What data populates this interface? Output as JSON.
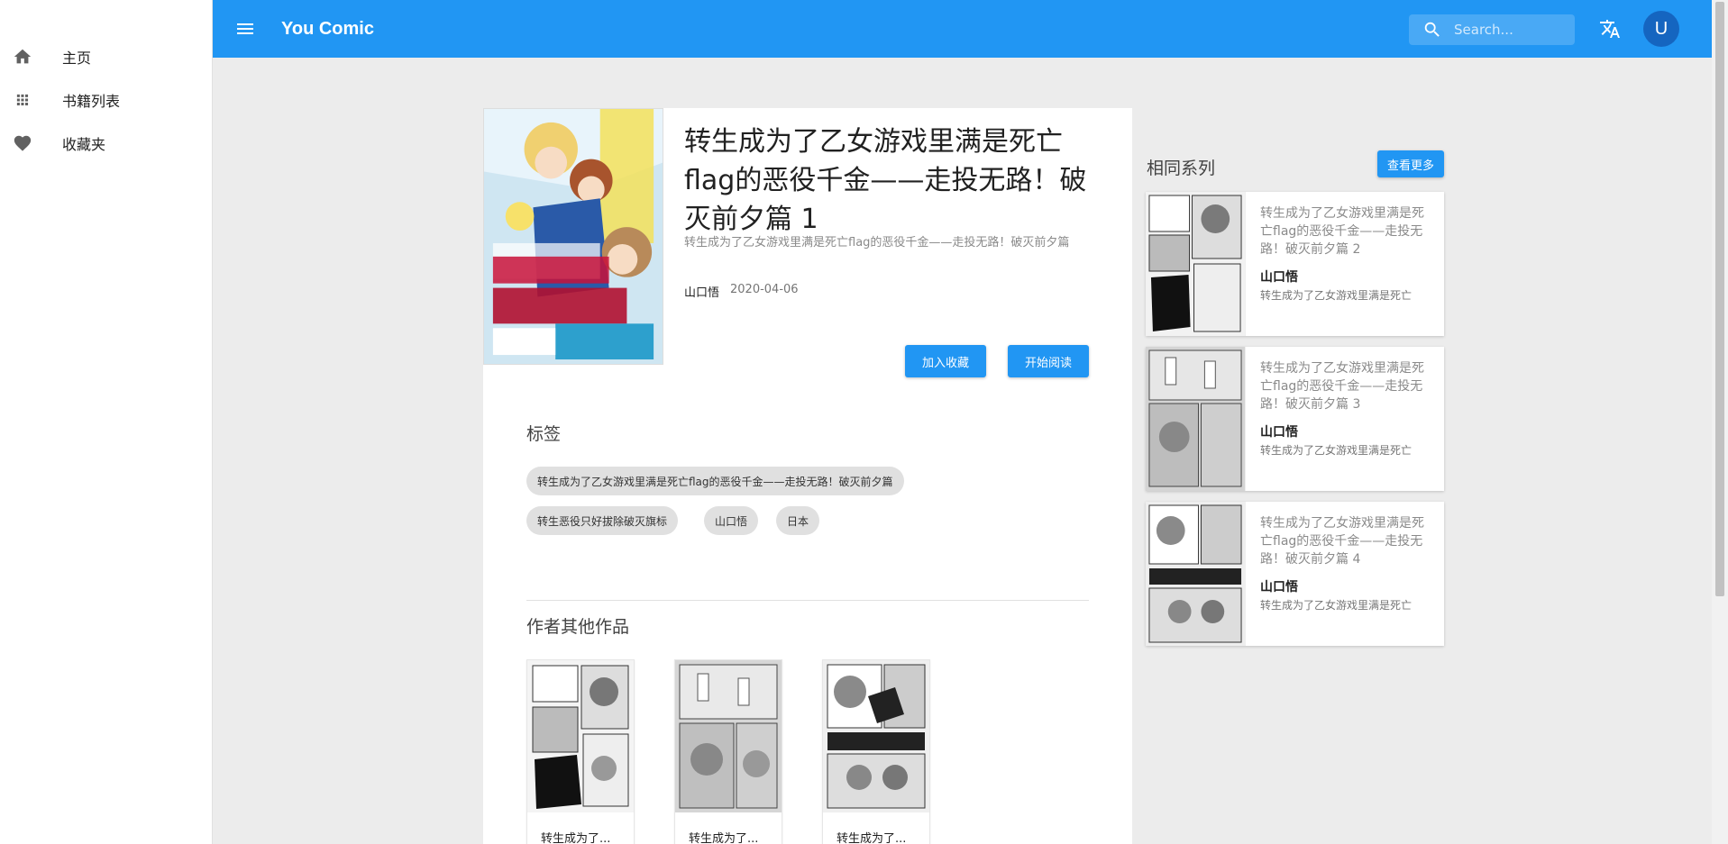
{
  "sidebar": {
    "items": [
      {
        "label": "主页",
        "icon": "home-icon"
      },
      {
        "label": "书籍列表",
        "icon": "apps-grid-icon"
      },
      {
        "label": "收藏夹",
        "icon": "heart-icon"
      }
    ]
  },
  "appbar": {
    "title": "You Comic",
    "search_placeholder": "Search...",
    "avatar_letter": "U",
    "color": "#2196f3"
  },
  "book": {
    "title": "转生成为了乙女游戏里满是死亡flag的恶役千金——走投无路！破灭前夕篇 1",
    "subtitle": "转生成为了乙女游戏里满是死亡flag的恶役千金——走投无路！破灭前夕篇",
    "author": "山口悟",
    "date": "2020-04-06",
    "favorite_label": "加入收藏",
    "read_label": "开始阅读"
  },
  "tags": {
    "title": "标签",
    "items": [
      "转生成为了乙女游戏里满是死亡flag的恶役千金——走投无路！破灭前夕篇",
      "转生恶役只好拔除破灭旗标",
      "山口悟",
      "日本"
    ]
  },
  "author_works": {
    "title": "作者其他作品",
    "items": [
      "转生成为了...",
      "转生成为了...",
      "转生成为了..."
    ]
  },
  "series": {
    "title": "相同系列",
    "more_label": "查看更多",
    "items": [
      {
        "name": "转生成为了乙女游戏里满是死亡flag的恶役千金——走投无路！破灭前夕篇 2",
        "author": "山口悟",
        "desc": "转生成为了乙女游戏里满是死亡"
      },
      {
        "name": "转生成为了乙女游戏里满是死亡flag的恶役千金——走投无路！破灭前夕篇 3",
        "author": "山口悟",
        "desc": "转生成为了乙女游戏里满是死亡"
      },
      {
        "name": "转生成为了乙女游戏里满是死亡flag的恶役千金——走投无路！破灭前夕篇 4",
        "author": "山口悟",
        "desc": "转生成为了乙女游戏里满是死亡"
      }
    ]
  }
}
